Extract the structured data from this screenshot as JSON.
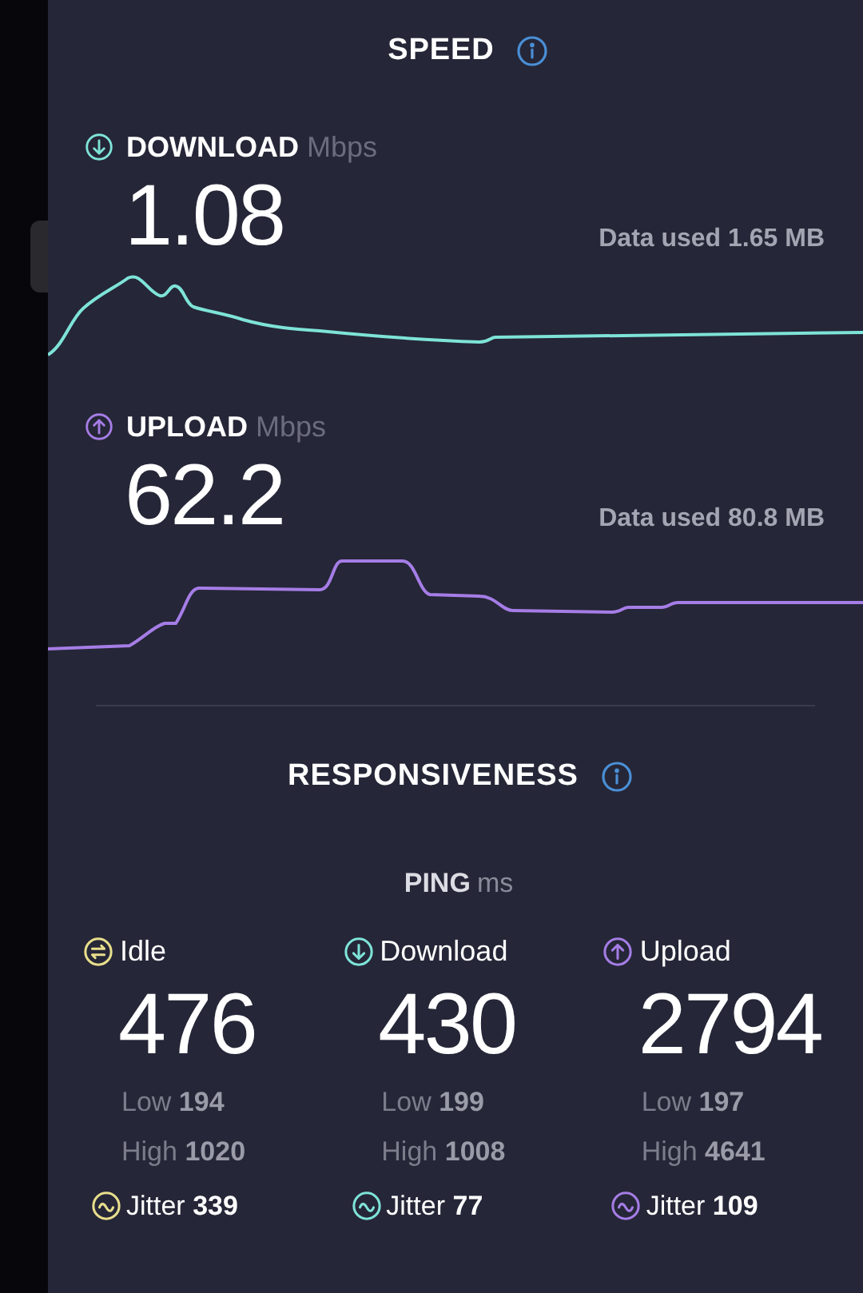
{
  "speed": {
    "title": "SPEED",
    "tests": [
      {
        "kind": "download",
        "label": "DOWNLOAD",
        "unit": "Mbps",
        "value": "1.08",
        "data_used": "Data used 1.65 MB",
        "color": "#7ee3d8"
      },
      {
        "kind": "upload",
        "label": "UPLOAD",
        "unit": "Mbps",
        "value": "62.2",
        "data_used": "Data used 80.8 MB",
        "color": "#a57de6"
      }
    ]
  },
  "responsiveness": {
    "title": "RESPONSIVENESS",
    "ping_label": "PING",
    "ping_unit": "ms",
    "columns": [
      {
        "kind": "idle",
        "label": "Idle",
        "value": "476",
        "low_label": "Low",
        "low": "194",
        "high_label": "High",
        "high": "1020",
        "jitter_label": "Jitter",
        "jitter": "339",
        "color": "#e8de8c"
      },
      {
        "kind": "download",
        "label": "Download",
        "value": "430",
        "low_label": "Low",
        "low": "199",
        "high_label": "High",
        "high": "1008",
        "jitter_label": "Jitter",
        "jitter": "77",
        "color": "#7ee3d8"
      },
      {
        "kind": "upload",
        "label": "Upload",
        "value": "2794",
        "low_label": "Low",
        "low": "197",
        "high_label": "High",
        "high": "4641",
        "jitter_label": "Jitter",
        "jitter": "109",
        "color": "#a57de6"
      }
    ]
  }
}
